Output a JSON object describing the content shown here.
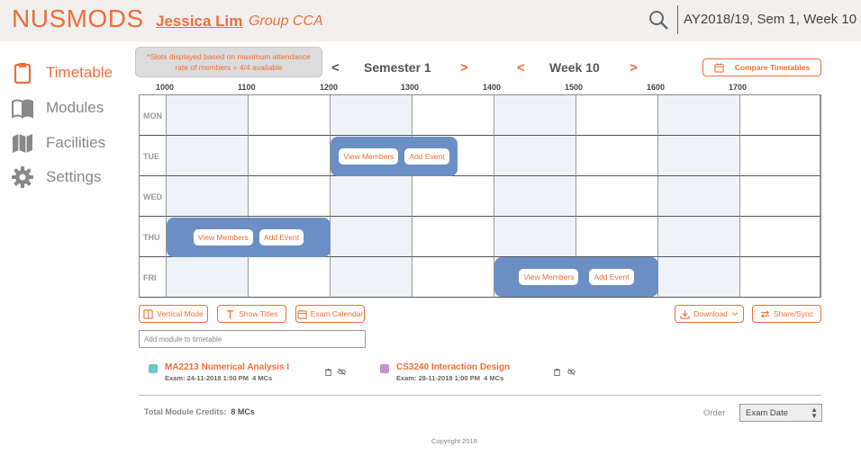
{
  "header": {
    "brand": "NUSMODS",
    "user": "Jessica Lim",
    "group": "Group CCA",
    "semester_info": "AY2018/19, Sem 1, Week 10"
  },
  "sidebar": {
    "items": [
      {
        "label": "Timetable",
        "icon": "clipboard-icon",
        "active": true
      },
      {
        "label": "Modules",
        "icon": "book-icon",
        "active": false
      },
      {
        "label": "Facilities",
        "icon": "map-icon",
        "active": false
      },
      {
        "label": "Settings",
        "icon": "gear-icon",
        "active": false
      }
    ]
  },
  "notice": {
    "line1": "*Slots displayed based on maximum attendance",
    "line2": "rate of members = 4/4 available"
  },
  "navigator": {
    "semester_label": "Semester 1",
    "week_label": "Week 10",
    "prev": "<",
    "next": ">"
  },
  "compare_button": "Compare Timetables",
  "hours": [
    "1000",
    "1100",
    "1200",
    "1300",
    "1400",
    "1500",
    "1600",
    "1700"
  ],
  "days": [
    "MON",
    "TUE",
    "WED",
    "THU",
    "FRI"
  ],
  "slot_buttons": {
    "view": "View Members",
    "add": "Add Event"
  },
  "toolbar": {
    "vertical_mode": "Vertical Mode",
    "show_titles": "Show Titles",
    "exam_calendar": "Exam Calendar",
    "download": "Download",
    "share": "Share/Sync"
  },
  "add_module_placeholder": "Add module to timetable",
  "modules": [
    {
      "name": "MA2213 Numerical Analysis I",
      "exam": "Exam: 24-11-2018 1:00 PM",
      "mcs": "4 MCs",
      "color": "#6cc8c8"
    },
    {
      "name": "CS3240 Interaction Design",
      "exam": "Exam: 28-11-2018 1:00 PM",
      "mcs": "4 MCs",
      "color": "#c792d0"
    }
  ],
  "footer": {
    "credits_label": "Total Module Credits:",
    "credits_value": "8 MCs",
    "order_label": "Order",
    "order_value": "Exam Date",
    "copyright": "Copyright 2018"
  },
  "colors": {
    "accent": "#ef6e3a",
    "slot": "#6b8fc5",
    "topbar": "#f1f0ef"
  }
}
